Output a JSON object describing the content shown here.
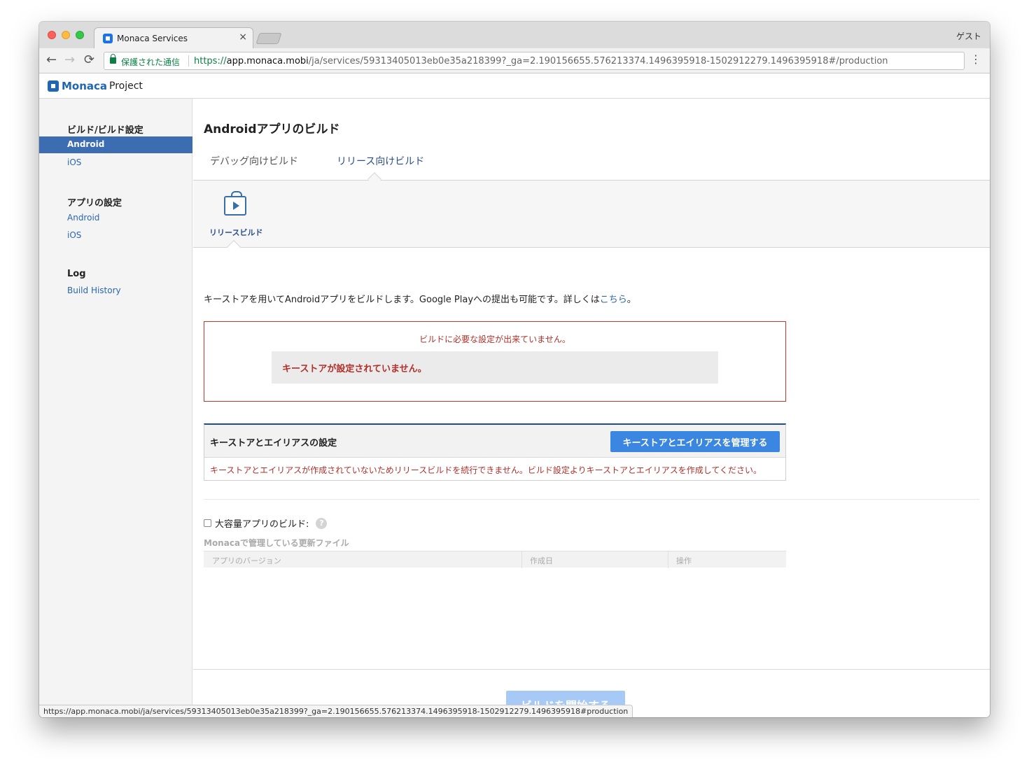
{
  "browser": {
    "tab_title": "Monaca Services",
    "tab_close": "×",
    "profile": "ゲスト",
    "secure_label": "保護された通信",
    "url_scheme": "https://",
    "url_host": "app.monaca.mobi",
    "url_path": "/ja/services/59313405013eb0e35a218399?_ga=2.190156655.576213374.1496395918-1502912279.1496395918#/production",
    "status_url": "https://app.monaca.mobi/ja/services/59313405013eb0e35a218399?_ga=2.190156655.576213374.1496395918-1502912279.1496395918#production",
    "back_icon": "←",
    "forward_icon": "→",
    "reload_icon": "⟳",
    "menu_icon": "⋮"
  },
  "header": {
    "logo": "Monaca",
    "project": "Project"
  },
  "sidebar": {
    "sections": [
      {
        "heading": "ビルド/ビルド設定",
        "items": [
          "Android",
          "iOS"
        ]
      },
      {
        "heading": "アプリの設定",
        "items": [
          "Android",
          "iOS"
        ]
      },
      {
        "heading": "Log",
        "items": [
          "Build History"
        ]
      }
    ],
    "active_item": "Android"
  },
  "main": {
    "title": "Androidアプリのビルド",
    "tabs": [
      {
        "label": "デバッグ向けビルド"
      },
      {
        "label": "リリース向けビルド",
        "active": true
      }
    ],
    "subnav_label": "リリースビルド",
    "intro_text": "キーストアを用いてAndroidアプリをビルドします。Google Playへの提出も可能です。詳しくは",
    "intro_link": "こちら",
    "intro_end": "。",
    "error": {
      "title": "ビルドに必要な設定が出来ていません。",
      "item": "キーストアが設定されていません。"
    },
    "keystore": {
      "title": "キーストアとエイリアスの設定",
      "button": "キーストアとエイリアスを管理する",
      "message": "キーストアとエイリアスが作成されていないためリリースビルドを続行できません。ビルド設定よりキーストアとエイリアスを作成してください。"
    },
    "large_build_label": "大容量アプリのビルド:",
    "help_icon": "?",
    "files_title": "Monacaで管理している更新ファイル",
    "files_columns": [
      "アプリのバージョン",
      "作成日",
      "操作"
    ],
    "start_button": "ビルドを開始する"
  },
  "colors": {
    "accent": "#3b86e0",
    "sidebar_active": "#3c6db3",
    "error": "#b0302a"
  }
}
